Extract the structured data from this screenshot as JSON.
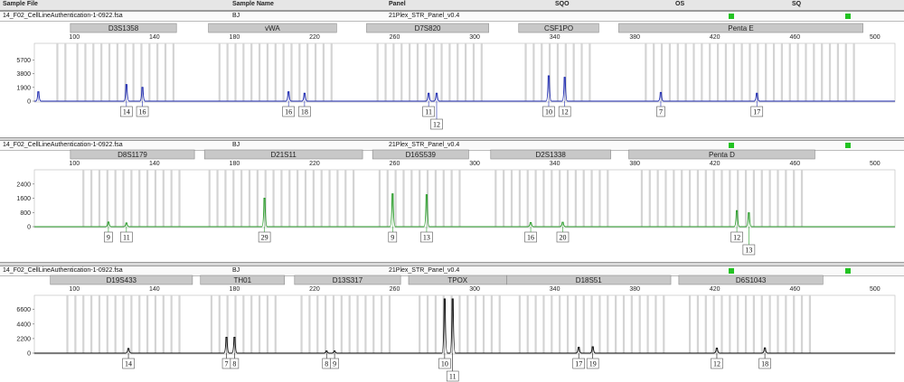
{
  "header": {
    "sample_file": "Sample File",
    "sample_name": "Sample Name",
    "panel": "Panel",
    "sqo": "SQO",
    "os": "OS",
    "sq": "SQ"
  },
  "colors": {
    "blue": "#1f2bb0",
    "green": "#2a9b2a",
    "black": "#111111",
    "marker_fill": "#c8c8c8",
    "bin_fill": "#d4d4d4",
    "qc_green": "#22c322"
  },
  "x_ticks": [
    100,
    140,
    180,
    220,
    260,
    300,
    340,
    380,
    420,
    460,
    500
  ],
  "chart_data": [
    {
      "type": "line",
      "file": "14_F02_CellLineAuthentication-1-0922.fsa",
      "sample": "BJ",
      "panel": "21Plex_STR_Panel_v0.4",
      "color": "blue",
      "xlim": [
        80,
        510
      ],
      "ylim": [
        0,
        7500
      ],
      "y_ticks": [
        "5700",
        "3800",
        "1900",
        "0"
      ],
      "y_tick_values": [
        5700,
        3800,
        1900,
        0
      ],
      "markers": [
        {
          "name": "D3S1358",
          "from": 98,
          "to": 151
        },
        {
          "name": "vWA",
          "from": 167,
          "to": 231
        },
        {
          "name": "D7S820",
          "from": 246,
          "to": 307
        },
        {
          "name": "CSF1PO",
          "from": 322,
          "to": 362
        },
        {
          "name": "Penta E",
          "from": 372,
          "to": 494
        }
      ],
      "bins": [
        [
          91,
          97
        ],
        [
          101,
          150
        ],
        [
          172,
          230
        ],
        [
          251,
          305
        ],
        [
          325,
          359
        ],
        [
          385,
          492
        ]
      ],
      "peaks": [
        {
          "x": 82,
          "h": 1300,
          "label": null
        },
        {
          "x": 126,
          "h": 2300,
          "label": "14",
          "row": 0
        },
        {
          "x": 134,
          "h": 1900,
          "label": "16",
          "row": 0
        },
        {
          "x": 207,
          "h": 1300,
          "label": "16",
          "row": 0
        },
        {
          "x": 215,
          "h": 1100,
          "label": "18",
          "row": 0
        },
        {
          "x": 277,
          "h": 1100,
          "label": "11",
          "row": 0
        },
        {
          "x": 281,
          "h": 1100,
          "label": "12",
          "row": 1
        },
        {
          "x": 337,
          "h": 3500,
          "label": "10",
          "row": 0
        },
        {
          "x": 345,
          "h": 3300,
          "label": "12",
          "row": 0
        },
        {
          "x": 393,
          "h": 1200,
          "label": "7",
          "row": 0
        },
        {
          "x": 441,
          "h": 1100,
          "label": "17",
          "row": 0
        }
      ]
    },
    {
      "type": "line",
      "file": "14_F02_CellLineAuthentication-1-0922.fsa",
      "sample": "BJ",
      "panel": "21Plex_STR_Panel_v0.4",
      "color": "green",
      "xlim": [
        80,
        510
      ],
      "ylim": [
        0,
        3000
      ],
      "y_ticks": [
        "2400",
        "1600",
        "800",
        "0"
      ],
      "y_tick_values": [
        2400,
        1600,
        800,
        0
      ],
      "markers": [
        {
          "name": "D8S1179",
          "from": 98,
          "to": 160
        },
        {
          "name": "D21S11",
          "from": 165,
          "to": 244
        },
        {
          "name": "D16S539",
          "from": 249,
          "to": 297
        },
        {
          "name": "D2S1338",
          "from": 308,
          "to": 368
        },
        {
          "name": "Penta D",
          "from": 377,
          "to": 470
        }
      ],
      "bins": [
        [
          104,
          154
        ],
        [
          167,
          242
        ],
        [
          252,
          295
        ],
        [
          310,
          366
        ],
        [
          383,
          466
        ]
      ],
      "peaks": [
        {
          "x": 117,
          "h": 260,
          "label": "9",
          "row": 0
        },
        {
          "x": 126,
          "h": 210,
          "label": "11",
          "row": 0
        },
        {
          "x": 195,
          "h": 1600,
          "label": "29",
          "row": 0
        },
        {
          "x": 259,
          "h": 1850,
          "label": "9",
          "row": 0
        },
        {
          "x": 276,
          "h": 1800,
          "label": "13",
          "row": 0
        },
        {
          "x": 328,
          "h": 230,
          "label": "16",
          "row": 0
        },
        {
          "x": 344,
          "h": 250,
          "label": "20",
          "row": 0
        },
        {
          "x": 431,
          "h": 900,
          "label": "12",
          "row": 0
        },
        {
          "x": 437,
          "h": 780,
          "label": "13",
          "row": 1
        }
      ]
    },
    {
      "type": "line",
      "file": "14_F02_CellLineAuthentication-1-0922.fsa",
      "sample": "BJ",
      "panel": "21Plex_STR_Panel_v0.4",
      "color": "black",
      "xlim": [
        80,
        510
      ],
      "ylim": [
        0,
        8200
      ],
      "y_ticks": [
        "6600",
        "4400",
        "2200",
        "0"
      ],
      "y_tick_values": [
        6600,
        4400,
        2200,
        0
      ],
      "markers": [
        {
          "name": "D19S433",
          "from": 88,
          "to": 159
        },
        {
          "name": "TH01",
          "from": 163,
          "to": 205
        },
        {
          "name": "D13S317",
          "from": 210,
          "to": 263
        },
        {
          "name": "TPOX",
          "from": 267,
          "to": 316
        },
        {
          "name": "D18S51",
          "from": 316,
          "to": 398
        },
        {
          "name": "D6S1043",
          "from": 402,
          "to": 474
        }
      ],
      "bins": [
        [
          96,
          152
        ],
        [
          168,
          200
        ],
        [
          213,
          258
        ],
        [
          272,
          312
        ],
        [
          322,
          395
        ],
        [
          407,
          470
        ]
      ],
      "peaks": [
        {
          "x": 127,
          "h": 700,
          "label": "14",
          "row": 0
        },
        {
          "x": 176,
          "h": 2400,
          "label": "7",
          "row": 0
        },
        {
          "x": 180,
          "h": 2400,
          "label": "8",
          "row": 0
        },
        {
          "x": 226,
          "h": 320,
          "label": "8",
          "row": 0
        },
        {
          "x": 230,
          "h": 320,
          "label": "9",
          "row": 0
        },
        {
          "x": 285,
          "h": 8200,
          "label": "10",
          "row": 0
        },
        {
          "x": 289,
          "h": 8200,
          "label": "11",
          "row": 1
        },
        {
          "x": 352,
          "h": 880,
          "label": "17",
          "row": 0
        },
        {
          "x": 359,
          "h": 950,
          "label": "19",
          "row": 0
        },
        {
          "x": 421,
          "h": 760,
          "label": "12",
          "row": 0
        },
        {
          "x": 445,
          "h": 780,
          "label": "18",
          "row": 0
        }
      ]
    }
  ]
}
